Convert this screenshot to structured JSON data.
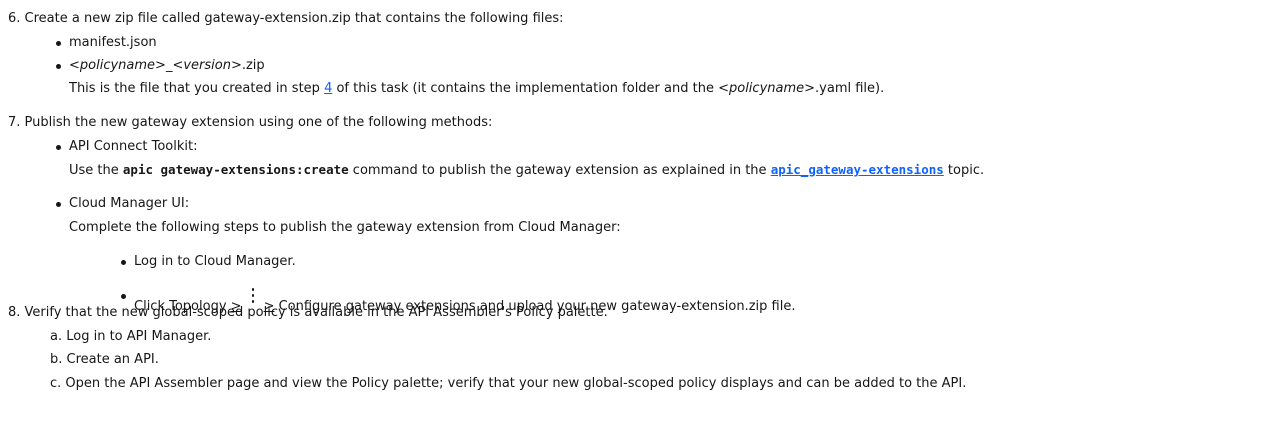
{
  "step6": {
    "text": "6. Create a new zip file called gateway-extension.zip that contains the following files:",
    "bullet1": "manifest.json",
    "bullet2_part1": "<policyname>",
    "bullet2_part2": "_",
    "bullet2_part3": "<version>",
    "bullet2_part4": ".zip",
    "desc_part1": "This is the file that you created in step ",
    "desc_link": "4",
    "desc_part2": " of this task (it contains the implementation folder and the ",
    "desc_italic": "<policyname>",
    "desc_part3": ".yaml file)."
  },
  "step7": {
    "text": "7. Publish the new gateway extension using one of the following methods:",
    "toolkit_label": "API Connect Toolkit:",
    "toolkit_part1": "Use the ",
    "toolkit_cmd": "apic gateway-extensions:create",
    "toolkit_part2": " command to publish the gateway extension as explained in the ",
    "toolkit_link": "apic_gateway-extensions",
    "toolkit_part3": " topic.",
    "cm_label": "Cloud Manager UI:",
    "cm_desc": "Complete the following steps to publish the gateway extension from Cloud Manager:",
    "cm_step1": "Log in to Cloud Manager.",
    "cm_step2_part1": "Click Topology ",
    "cm_step2_sep1": ">",
    "cm_step2_sep2": ">",
    "cm_step2_part2": " Configure gateway extensions and upload your new gateway-extension.zip file.",
    "cm_step2_icon": "overflow-menu-vertical-icon"
  },
  "step8": {
    "text": "8. Verify that the new global-scoped policy is available in the API Assembler's Policy palette.",
    "a": "a. Log in to API Manager.",
    "b": "b. Create an API.",
    "c": "c. Open the API Assembler page and view the Policy palette; verify that your new global-scoped policy displays and can be added to the API."
  }
}
